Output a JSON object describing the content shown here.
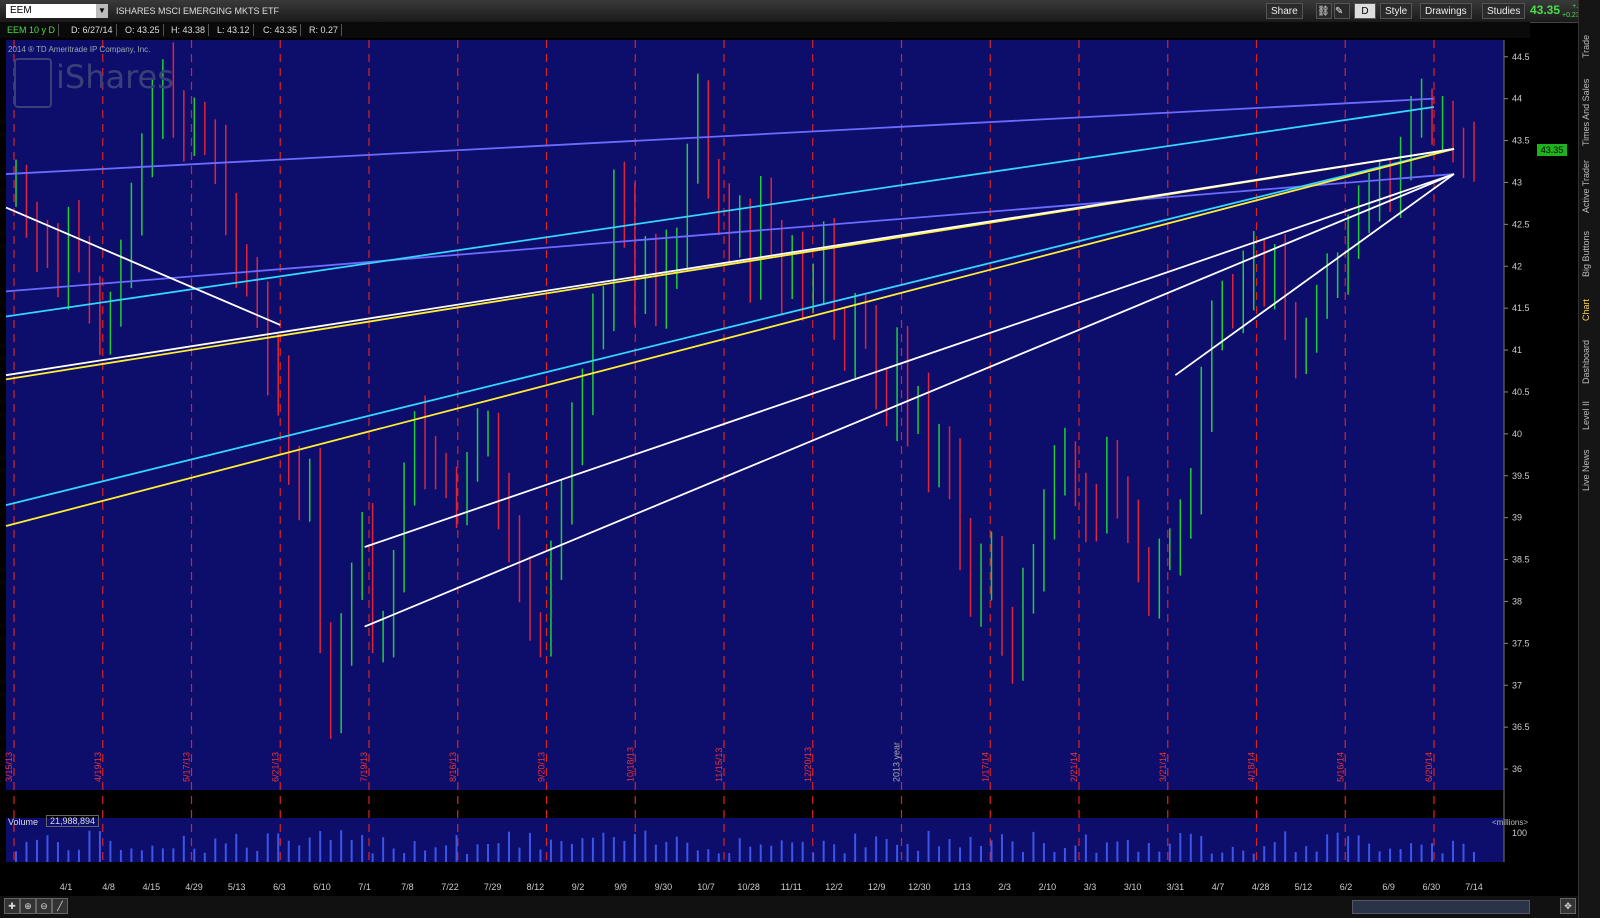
{
  "header": {
    "symbol": "EEM",
    "dropdown": "▼",
    "name": "ISHARES MSCI EMERGING MKTS ETF",
    "share_label": "Share",
    "style_label": "Style",
    "drawings_label": "Drawings",
    "studies_label": "Studies",
    "aggregation_label": "D",
    "last_price": "43.35",
    "change_abs": "+.10",
    "change_pct": "+0.23%"
  },
  "info": {
    "period": "EEM 10 y D",
    "date": "D: 6/27/14",
    "open": "O: 43.25",
    "high": "H: 43.38",
    "low": "L: 43.12",
    "close": "C: 43.35",
    "range": "R: 0.27"
  },
  "watermark": {
    "copyright": "2014 ® TD Ameritrade IP Company, Inc.",
    "brand": "iShares"
  },
  "sidebar": {
    "tabs": [
      "Trade",
      "Times And Sales",
      "Active Trader",
      "Big Buttons",
      "Chart",
      "Dashboard",
      "Level II",
      "Live News"
    ]
  },
  "volume": {
    "label": "Volume",
    "value": "21,988,894",
    "unit": "<millions>"
  },
  "chart_data": {
    "type": "bar",
    "title": "",
    "ylim": [
      35.75,
      44.7
    ],
    "yticks": [
      36,
      36.5,
      37,
      37.5,
      38,
      38.5,
      39,
      39.5,
      40,
      40.5,
      41,
      41.5,
      42,
      42.5,
      43,
      43.5,
      44,
      44.5
    ],
    "xticks": [
      "4/1",
      "4/8",
      "4/15",
      "4/29",
      "5/13",
      "6/3",
      "6/10",
      "7/1",
      "7/8",
      "7/22",
      "7/29",
      "8/12",
      "9/2",
      "9/9",
      "9/30",
      "10/7",
      "10/28",
      "11/11",
      "12/2",
      "12/9",
      "12/30",
      "1/13",
      "2/3",
      "2/10",
      "3/3",
      "3/10",
      "3/31",
      "4/7",
      "4/28",
      "5/12",
      "6/2",
      "6/9",
      "6/30",
      "7/14"
    ],
    "month_markers": [
      "3/15/13",
      "4/19/13",
      "5/17/13",
      "6/21/13",
      "7/19/13",
      "8/16/13",
      "9/20/13",
      "10/18/13",
      "11/15/13",
      "12/20/13",
      "2013 year",
      "1/17/14",
      "2/21/14",
      "3/21/14",
      "4/18/14",
      "5/16/14",
      "6/20/14"
    ],
    "closes": [
      43.0,
      42.6,
      42.3,
      42.2,
      41.8,
      42.5,
      42.2,
      41.7,
      41.2,
      41.5,
      42.0,
      42.6,
      43.3,
      43.9,
      44.3,
      43.8,
      43.5,
      43.7,
      43.5,
      43.3,
      42.6,
      42.0,
      41.9,
      41.6,
      40.8,
      40.6,
      39.7,
      39.2,
      39.5,
      37.6,
      36.6,
      37.6,
      38.2,
      38.8,
      37.6,
      37.7,
      38.3,
      39.3,
      40.1,
      39.7,
      39.5,
      39.4,
      39.1,
      39.6,
      40.0,
      40.1,
      39.2,
      38.7,
      38.3,
      37.7,
      37.5,
      38.5,
      39.2,
      40.0,
      40.6,
      41.4,
      41.5,
      42.9,
      42.6,
      41.6,
      42.1,
      41.6,
      42.1,
      42.2,
      43.3,
      43.9,
      43.0,
      42.6,
      42.3,
      42.6,
      41.9,
      42.7,
      42.3,
      41.8,
      42.2,
      41.6,
      41.8,
      42.2,
      41.3,
      41.0,
      41.5,
      41.3,
      40.5,
      40.3,
      40.9,
      40.2,
      40.4,
      39.6,
      39.9,
      39.6,
      38.7,
      38.0,
      38.3,
      38.6,
      37.6,
      37.3,
      38.1,
      38.5,
      39.0,
      39.5,
      39.7,
      39.3,
      39.1,
      39.0,
      39.7,
      39.2,
      38.9,
      38.5,
      38.1,
      38.6,
      38.7,
      38.9,
      39.4,
      40.4,
      41.3,
      41.6,
      41.5,
      41.8,
      42.1,
      41.7,
      42.1,
      41.4,
      40.9,
      41.2,
      41.6,
      41.9,
      41.9,
      42.3,
      42.7,
      42.9,
      43.0,
      42.9,
      43.2,
      43.7,
      43.9,
      43.6,
      43.7,
      43.5,
      43.4,
      43.35
    ],
    "trendlines": [
      {
        "color": "#6b6bff",
        "p1": [
          "start",
          43.1
        ],
        "p2": [
          "6/20/14",
          44.0
        ]
      },
      {
        "color": "#6b6bff",
        "p1": [
          "start",
          41.7
        ],
        "p2": [
          "6/27/14",
          43.1
        ]
      },
      {
        "color": "#33d6ff",
        "p1": [
          "start",
          41.4
        ],
        "p2": [
          "6/20/14",
          43.9
        ]
      },
      {
        "color": "#33d6ff",
        "p1": [
          "start",
          39.15
        ],
        "p2": [
          "6/27/14",
          43.4
        ]
      },
      {
        "color": "#ffee33",
        "p1": [
          "start",
          40.65
        ],
        "p2": [
          "6/27/14",
          43.4
        ]
      },
      {
        "color": "#ffee33",
        "p1": [
          "start",
          38.9
        ],
        "p2": [
          "6/27/14",
          43.4
        ]
      },
      {
        "color": "#ffffff",
        "p1": [
          "start",
          40.7
        ],
        "p2": [
          "6/27/14",
          43.4
        ]
      },
      {
        "color": "#ffffff",
        "p1": [
          "6/21/13",
          41.3
        ],
        "p2": [
          "6/9/14",
          42.7
        ]
      },
      {
        "color": "#ffffff",
        "p1": [
          "7/1",
          38.65
        ],
        "p2": [
          "6/27/14",
          43.1
        ]
      },
      {
        "color": "#ffffff",
        "p1": [
          "7/1",
          37.7
        ],
        "p2": [
          "6/27/14",
          43.1
        ]
      },
      {
        "color": "#ffffff",
        "p1": [
          "3/31",
          40.7
        ],
        "p2": [
          "6/27/14",
          43.1
        ]
      }
    ]
  }
}
